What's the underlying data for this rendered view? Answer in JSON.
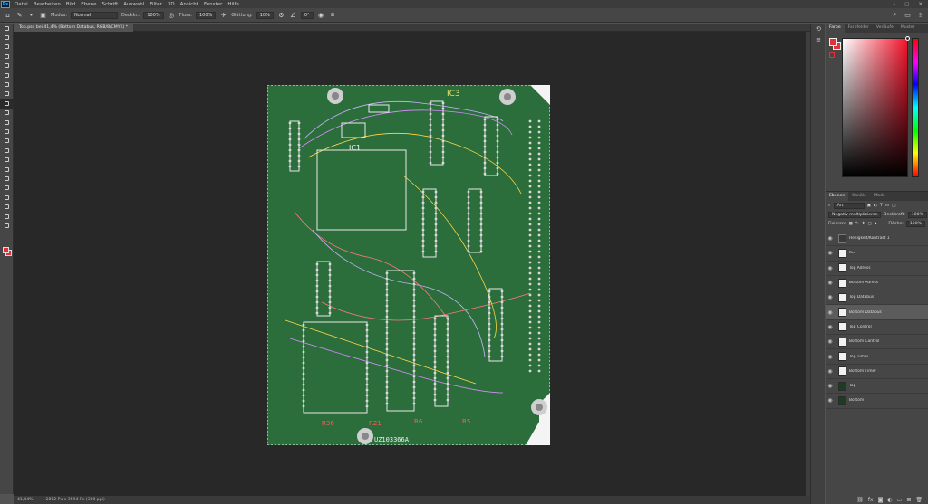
{
  "app": {
    "logo_text": "Ps"
  },
  "menu": [
    "Datei",
    "Bearbeiten",
    "Bild",
    "Ebene",
    "Schrift",
    "Auswahl",
    "Filter",
    "3D",
    "Ansicht",
    "Fenster",
    "Hilfe"
  ],
  "options_bar": {
    "modus_label": "Modus:",
    "modus_value": "Normal",
    "deckkraft_label": "Deckkr.:",
    "deckkraft_value": "100%",
    "fluss_label": "Fluss:",
    "fluss_value": "100%",
    "glaettung_label": "Glättung:",
    "glaettung_value": "10%",
    "angle_value": "0°"
  },
  "document": {
    "tab_title": "Top.psd bei 41,4% (Bottom Databus, RGB/8/CMYK) *",
    "zoom": "41,44%",
    "doc_info": "2812 Px x 3594 Px (300 ppi)"
  },
  "pcb_labels": {
    "ic_top": "IC3",
    "ic_mid": "IC1",
    "bottom_text": "UZ103366A",
    "red_labels": [
      "R36",
      "R21",
      "R6",
      "R5"
    ]
  },
  "color_panel": {
    "tabs": [
      "Farbe",
      "Farbfelder",
      "Verläufe",
      "Muster"
    ],
    "foreground": "#e03238",
    "background": "#e03238",
    "hue_color": "#f5142c"
  },
  "layers_panel": {
    "tabs": [
      "Ebenen",
      "Kanäle",
      "Pfade"
    ],
    "filter_value": "Art",
    "blend_mode": "Negativ multiplizieren",
    "opacity_label": "Deckkraft:",
    "opacity_value": "100%",
    "fixieren_label": "Fixieren:",
    "flaeche_label": "Fläche:",
    "flaeche_value": "100%",
    "layers": [
      {
        "name": "Helligkeit/Kontrast 1",
        "thumb": "adj",
        "selected": false
      },
      {
        "name": "IC3",
        "thumb": "light",
        "selected": false
      },
      {
        "name": "Top Adress",
        "thumb": "light",
        "selected": false
      },
      {
        "name": "Bottom Adress",
        "thumb": "light",
        "selected": false
      },
      {
        "name": "Top Databus",
        "thumb": "light",
        "selected": false
      },
      {
        "name": "Bottom Databus",
        "thumb": "light",
        "selected": true
      },
      {
        "name": "Top Control",
        "thumb": "light",
        "selected": false
      },
      {
        "name": "Bottom Control",
        "thumb": "light",
        "selected": false
      },
      {
        "name": "Top Timer",
        "thumb": "light",
        "selected": false
      },
      {
        "name": "Bottom Timer",
        "thumb": "light",
        "selected": false
      },
      {
        "name": "Top",
        "thumb": "dark",
        "selected": false
      },
      {
        "name": "Bottom",
        "thumb": "dark",
        "selected": false
      }
    ]
  }
}
